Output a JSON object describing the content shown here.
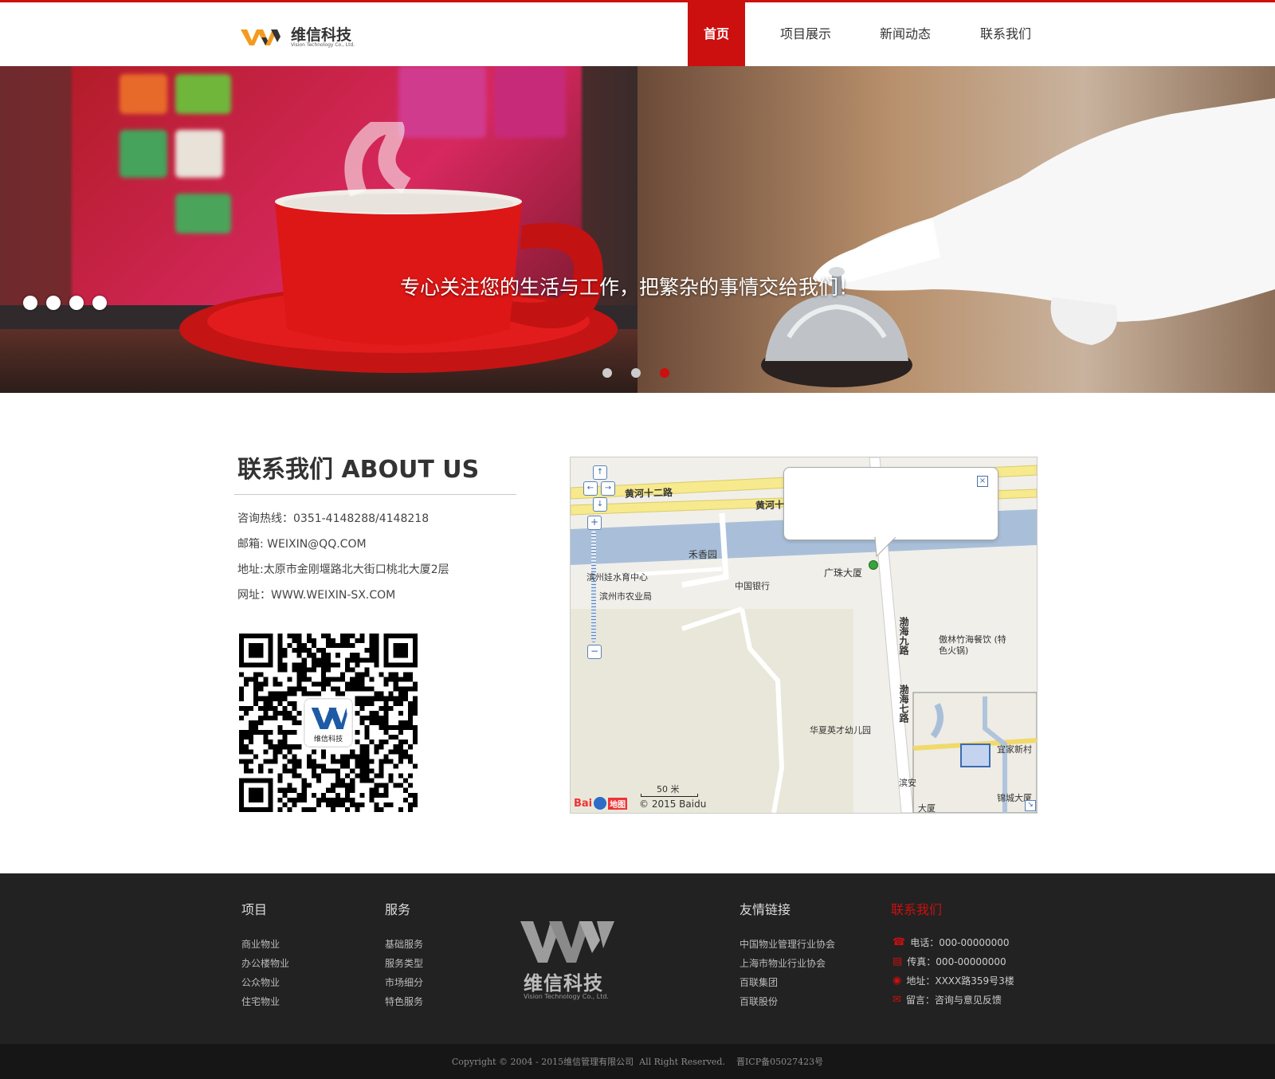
{
  "brand": {
    "name": "维信科技",
    "sub": "Vision Technology Co., Ltd.",
    "accent": "#cc0f0f",
    "logo_orange": "#f29b1f"
  },
  "nav": [
    {
      "label": "首页",
      "active": true
    },
    {
      "label": "项目展示",
      "active": false
    },
    {
      "label": "新闻动态",
      "active": false
    },
    {
      "label": "联系我们",
      "active": false
    }
  ],
  "banner": {
    "slogan": "专心关注您的生活与工作，把繁杂的事情交给我们！",
    "slide_count": 3,
    "active_slide": 3
  },
  "about": {
    "title": "联系我们 ABOUT US",
    "hotline": "咨询热线：0351-4148288/4148218",
    "email": "邮箱: WEIXIN@QQ.COM",
    "address": "地址:太原市金刚堰路北大街口桃北大厦2层",
    "website": "网址：WWW.WEIXIN-SX.COM",
    "qr_label": "维信科技"
  },
  "map": {
    "roads": [
      "黄河十二路",
      "黄河十",
      "渤海九路",
      "渤海七路"
    ],
    "pois": [
      "禾香园",
      "广珠大厦",
      "中国银行",
      "滨州市农业局",
      "滨州娃水育中心",
      "傲林竹海餐饮 (特色火锅)",
      "华夏英才幼儿园",
      "锦城大厦",
      "宜家新村",
      "滨安",
      "大厦"
    ],
    "scale": "50 米",
    "copyright": "© 2015 Baidu",
    "logo_text": "Bai",
    "logo_suffix": "地图"
  },
  "footer": {
    "projects": {
      "title": "项目",
      "links": [
        "商业物业",
        "办公楼物业",
        "公众物业",
        "住宅物业"
      ]
    },
    "services": {
      "title": "服务",
      "links": [
        "基础服务",
        "服务类型",
        "市场细分",
        "特色服务"
      ]
    },
    "friends": {
      "title": "友情链接",
      "links": [
        "中国物业管理行业协会",
        "上海市物业行业协会",
        "百联集团",
        "百联股份"
      ]
    },
    "contact": {
      "title": "联系我们",
      "phone": "电话：000-00000000",
      "fax": "传真：000-00000000",
      "address": "地址：XXXX路359号3楼",
      "message": "留言：咨询与意见反馈"
    },
    "logo_name": "维信科技",
    "logo_sub": "Vision Technology Co., Ltd."
  },
  "copyright": "Copyright © 2004 - 2015维信管理有限公司  All Right Reserved.    晋ICP备05027423号"
}
